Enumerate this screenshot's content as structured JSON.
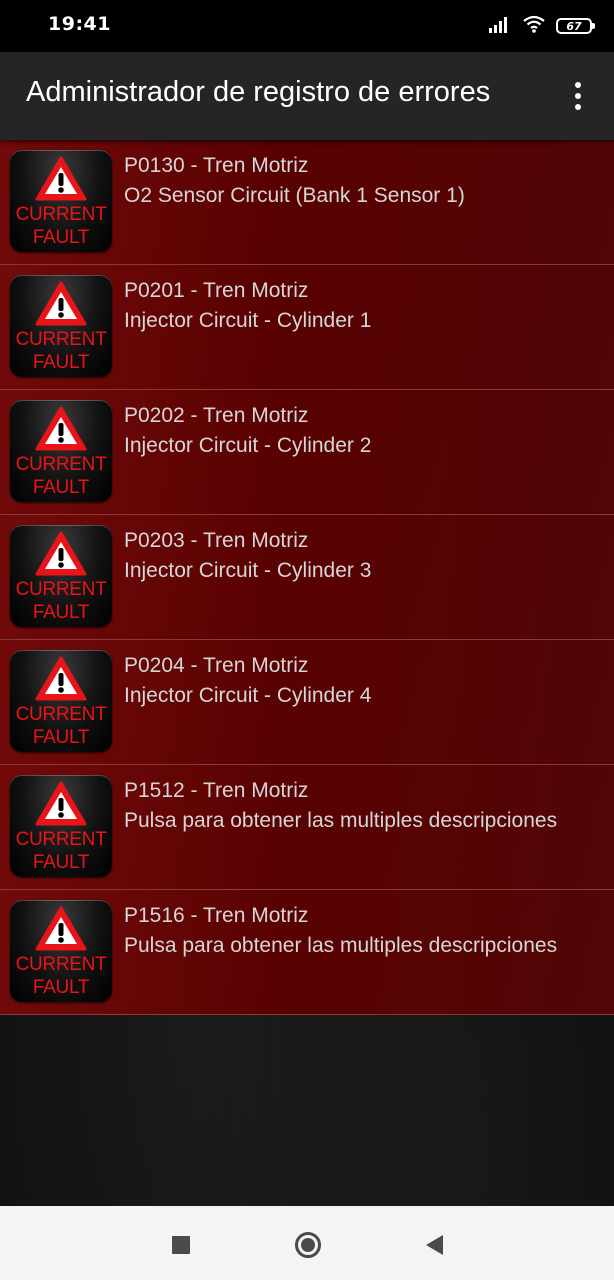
{
  "status_bar": {
    "time": "19:41",
    "battery": "67",
    "icons": [
      "signal-icon",
      "wifi-icon",
      "battery-icon"
    ]
  },
  "app_bar": {
    "title": "Administrador de registro de errores",
    "menu_icon": "more-vert-icon"
  },
  "badge": {
    "line1": "CURRENT",
    "line2": "FAULT",
    "icon": "warning-triangle-icon",
    "text_color": "#e8141a"
  },
  "faults": [
    {
      "code": "P0130 - Tren Motriz",
      "description": "O2 Sensor Circuit (Bank 1 Sensor 1)"
    },
    {
      "code": "P0201 - Tren Motriz",
      "description": "Injector Circuit - Cylinder 1"
    },
    {
      "code": "P0202 - Tren Motriz",
      "description": "Injector Circuit - Cylinder 2"
    },
    {
      "code": "P0203 - Tren Motriz",
      "description": "Injector Circuit - Cylinder 3"
    },
    {
      "code": "P0204 - Tren Motriz",
      "description": "Injector Circuit - Cylinder 4"
    },
    {
      "code": "P1512 - Tren Motriz",
      "description": "Pulsa para obtener las multiples descripciones"
    },
    {
      "code": "P1516 - Tren Motriz",
      "description": "Pulsa para obtener las multiples descripciones"
    }
  ],
  "nav_bar": {
    "recents_icon": "square-icon",
    "home_icon": "circle-icon",
    "back_icon": "triangle-back-icon"
  },
  "colors": {
    "row_background": "#6e0606",
    "app_bar": "#252525",
    "status_bar": "#000000"
  }
}
